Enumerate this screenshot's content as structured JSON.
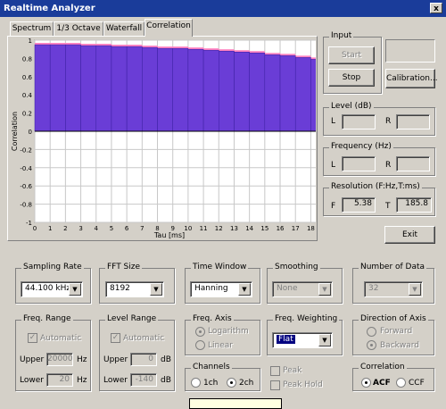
{
  "window": {
    "title": "Realtime Analyzer",
    "close_glyph": "x"
  },
  "tabs": [
    {
      "label": "Spectrum"
    },
    {
      "label": "1/3 Octave"
    },
    {
      "label": "Waterfall"
    },
    {
      "label": "Correlation"
    }
  ],
  "chart_data": {
    "type": "bar",
    "xlabel": "Tau [ms]",
    "ylabel": "Correlation",
    "xlim": [
      0,
      18.5
    ],
    "ylim": [
      -1,
      1
    ],
    "x_ticks": [
      "0",
      "1",
      "2",
      "3",
      "4",
      "5",
      "6",
      "7",
      "8",
      "9",
      "10",
      "11",
      "12",
      "13",
      "14",
      "15",
      "16",
      "17",
      "18"
    ],
    "y_ticks": [
      "1",
      "0.8",
      "0.6",
      "0.4",
      "0.2",
      "0",
      "-0.2",
      "-0.4",
      "-0.6",
      "-0.8",
      "-1"
    ],
    "series": [
      {
        "color": "#6a3dd6",
        "x": [
          0,
          1,
          2,
          3,
          4,
          5,
          6,
          7,
          8,
          9,
          10,
          11,
          12,
          13,
          14,
          15,
          16,
          17,
          18
        ],
        "values": [
          0.95,
          0.95,
          0.95,
          0.94,
          0.94,
          0.93,
          0.93,
          0.92,
          0.91,
          0.91,
          0.9,
          0.89,
          0.88,
          0.87,
          0.86,
          0.84,
          0.83,
          0.81,
          0.79
        ]
      },
      {
        "color": "#ff80c0",
        "x": [
          0,
          1,
          2,
          3,
          4,
          5,
          6,
          7,
          8,
          9,
          10,
          11,
          12,
          13,
          14,
          15,
          16,
          17,
          18
        ],
        "values": [
          0.97,
          0.97,
          0.97,
          0.96,
          0.96,
          0.95,
          0.95,
          0.94,
          0.93,
          0.93,
          0.92,
          0.91,
          0.9,
          0.89,
          0.88,
          0.86,
          0.85,
          0.83,
          0.81
        ]
      }
    ],
    "grid": true
  },
  "input": {
    "label": "Input",
    "start_label": "Start",
    "stop_label": "Stop",
    "calibration_label": "Calibration..."
  },
  "level": {
    "label": "Level (dB)",
    "l_label": "L",
    "r_label": "R"
  },
  "frequency": {
    "label": "Frequency (Hz)",
    "l_label": "L",
    "r_label": "R"
  },
  "resolution": {
    "label": "Resolution (F:Hz,T:ms)",
    "f_label": "F",
    "f_value": "5.38",
    "t_label": "T",
    "t_value": "185.8"
  },
  "exit_label": "Exit",
  "sampling_rate": {
    "label": "Sampling Rate",
    "value": "44.100 kHz"
  },
  "fft_size": {
    "label": "FFT Size",
    "value": "8192"
  },
  "time_window": {
    "label": "Time Window",
    "value": "Hanning"
  },
  "smoothing": {
    "label": "Smoothing",
    "value": "None"
  },
  "number_of_data": {
    "label": "Number of Data",
    "value": "32"
  },
  "freq_range": {
    "label": "Freq. Range",
    "automatic_label": "Automatic",
    "upper_label": "Upper",
    "upper_value": "20000",
    "upper_unit": "Hz",
    "lower_label": "Lower",
    "lower_value": "20",
    "lower_unit": "Hz"
  },
  "level_range": {
    "label": "Level Range",
    "automatic_label": "Automatic",
    "upper_label": "Upper",
    "upper_value": "0",
    "upper_unit": "dB",
    "lower_label": "Lower",
    "lower_value": "-140",
    "lower_unit": "dB"
  },
  "freq_axis": {
    "label": "Freq. Axis",
    "logarithm_label": "Logarithm",
    "linear_label": "Linear"
  },
  "freq_weighting": {
    "label": "Freq. Weighting",
    "value": "Flat"
  },
  "direction_of_axis": {
    "label": "Direction of Axis",
    "forward_label": "Forward",
    "backward_label": "Backward"
  },
  "channels": {
    "label": "Channels",
    "ch1_label": "1ch",
    "ch2_label": "2ch"
  },
  "peak": {
    "peak_label": "Peak",
    "peak_hold_label": "Peak Hold"
  },
  "correlation": {
    "label": "Correlation",
    "acf_label": "ACF",
    "ccf_label": "CCF"
  }
}
